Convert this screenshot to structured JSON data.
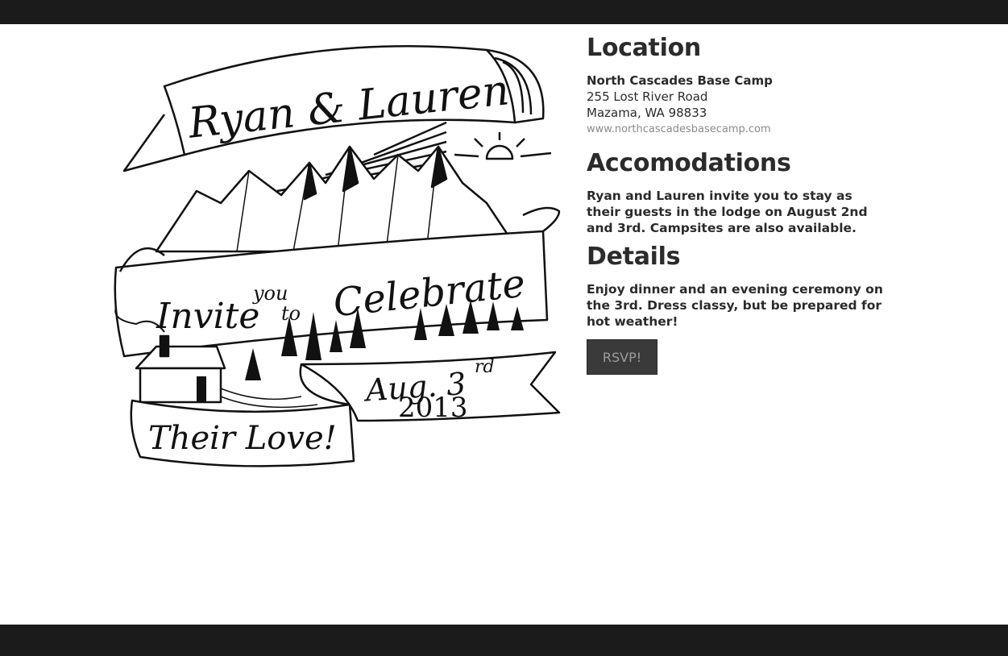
{
  "illustration": {
    "line1": "Ryan & Lauren",
    "line2_a": "Invite",
    "line2_b": "you",
    "line2_c": "to",
    "line2_d": "Celebrate",
    "line3": "Their Love!",
    "date_a": "Aug. 3",
    "date_sup": "rd",
    "date_year": "2013"
  },
  "location": {
    "heading": "Location",
    "venue": "North Cascades Base Camp",
    "street": "255 Lost River Road",
    "city": "Mazama, WA 98833",
    "website": "www.northcascadesbasecamp.com"
  },
  "accommodations": {
    "heading": "Accomodations",
    "text": "Ryan and Lauren invite you to stay as their guests in the lodge on August 2nd and 3rd. Campsites are also available."
  },
  "details": {
    "heading": "Details",
    "text": "Enjoy dinner and an evening ceremony on the 3rd. Dress classy, but be prepared for hot weather!"
  },
  "rsvp": {
    "label": "RSVP!"
  },
  "colors": {
    "bar": "#1b1b1b",
    "text": "#2b2b2b",
    "link": "#8a8a8a",
    "button": "#3a3a3a"
  }
}
